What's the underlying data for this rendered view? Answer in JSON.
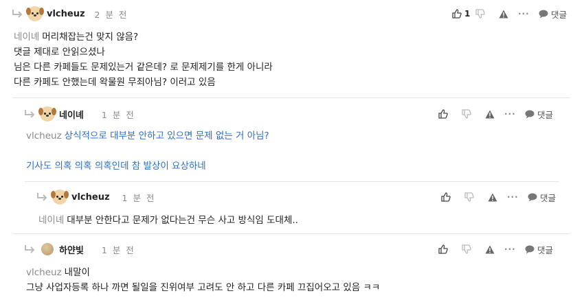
{
  "comments": [
    {
      "author": "vlcheuz",
      "time": "2 분 전",
      "like_count": "1",
      "reply_label": "댓글",
      "more": "···",
      "mention": "네이녜",
      "lines": [
        "머리채잡는건 맞지 않음?",
        "댓글 제대로 안읽으셨나",
        "님은 다른 카페들도 문제있는거 같은데? 로 문제제기를 한게 아니라",
        "다른 카페도 안했는데 왁물원 무죄아님? 이러고 있음"
      ]
    },
    {
      "author": "네이녜",
      "time": "1 분 전",
      "reply_label": "댓글",
      "more": "···",
      "mention": "vlcheuz",
      "lines": [
        "상식적으로 대부분 안하고 있으면 문제 없는 거 아님?",
        "",
        "기사도 의혹 의혹 의혹인데 참 발상이 요상하네"
      ]
    },
    {
      "author": "vlcheuz",
      "time": "1 분 전",
      "reply_label": "댓글",
      "more": "···",
      "mention": "네이녜",
      "lines": [
        "대부분 안한다고 문제가 없다는건 무슨 사고 방식임 도대체.."
      ]
    },
    {
      "author": "하얀빛",
      "time": "1 분 전",
      "reply_label": "댓글",
      "more": "···",
      "mention": "vlcheuz",
      "lines": [
        "내말이",
        "그냥 사업자등록 하나 까면 될일을 진위여부 고려도 안 하고 다른 카페 끄집어오고 있음 ㅋㅋ"
      ]
    }
  ]
}
